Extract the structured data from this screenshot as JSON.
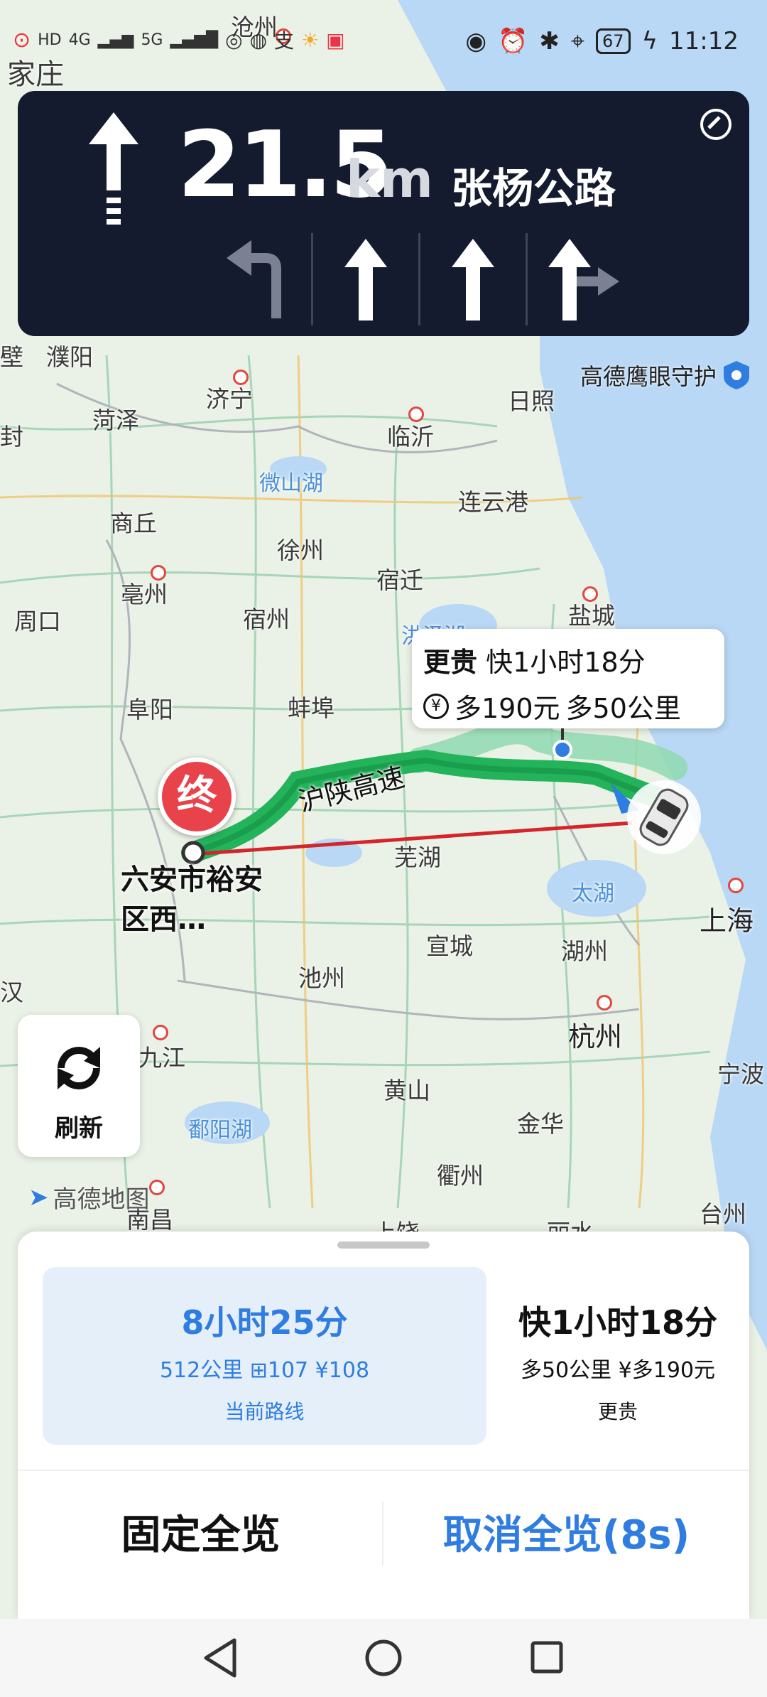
{
  "status_bar": {
    "left_indicators": [
      "HD",
      "4G",
      "HD",
      "5G"
    ],
    "battery": "67",
    "time": "11:12"
  },
  "navigation": {
    "distance": "21.5",
    "unit": "km",
    "road": "张杨公路"
  },
  "map": {
    "eagle_eye": "高德鹰眼守护",
    "highway_label": "沪陕高速",
    "labels": [
      "沧州",
      "家庄",
      "濮阳",
      "菏泽",
      "济宁",
      "临沂",
      "日照",
      "微山湖",
      "连云港",
      "商丘",
      "徐州",
      "亳州",
      "宿迁",
      "周口",
      "宿州",
      "盐城",
      "洪泽湖",
      "阜阳",
      "蚌埠",
      "芜湖",
      "太湖",
      "上海",
      "宣城",
      "湖州",
      "池州",
      "杭州",
      "九江",
      "黄山",
      "宁波",
      "鄱阳湖",
      "金华",
      "衢州",
      "南昌",
      "台州",
      "上饶",
      "丽水",
      "汉",
      "封",
      "壁"
    ],
    "destination": "六安市裕安区西…",
    "end_marker": "终",
    "logo": "高德地图"
  },
  "callout": {
    "tag": "更贵",
    "time_text": "快1小时18分",
    "cost_text": "多190元",
    "distance_text": "多50公里"
  },
  "refresh": {
    "label": "刷新"
  },
  "routes": [
    {
      "time": "8小时25分",
      "meta": "512公里 ⊞107 ¥108",
      "sub": "当前路线"
    },
    {
      "time": "快1小时18分",
      "meta": "多50公里 ¥多190元",
      "sub": "更贵"
    }
  ],
  "actions": {
    "fixed": "固定全览",
    "cancel": "取消全览(8s)"
  },
  "colors": {
    "nav_card": "#141b2e",
    "accent": "#2f7de0",
    "route": "#23b35a",
    "end_marker": "#e8434a"
  }
}
